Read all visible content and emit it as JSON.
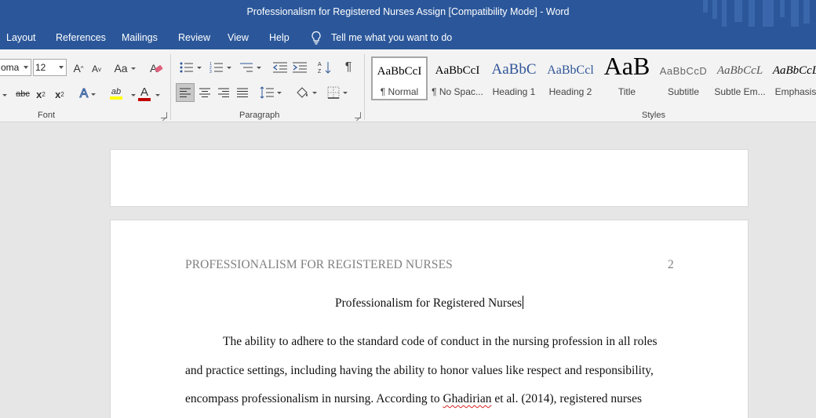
{
  "window": {
    "title": "Professionalism for Registered Nurses Assign [Compatibility Mode]  -  Word"
  },
  "menu": {
    "tabs": [
      "Layout",
      "References",
      "Mailings",
      "Review",
      "View",
      "Help"
    ],
    "tell_me": "Tell me what you want to do"
  },
  "ribbon": {
    "font": {
      "name": "oma",
      "size": "12",
      "grow_glyph": "A",
      "shrink_glyph": "A",
      "case_glyph": "Aa",
      "strike_glyph": "abc",
      "subscript_glyph": "x",
      "superscript_glyph": "x",
      "effects_glyph": "A",
      "highlight_glyph": "ab",
      "color_glyph": "A",
      "label": "Font"
    },
    "paragraph": {
      "pilcrow": "¶",
      "label": "Paragraph"
    },
    "styles": {
      "label": "Styles",
      "items": [
        {
          "sample": "AaBbCcI",
          "name": "¶ Normal"
        },
        {
          "sample": "AaBbCcI",
          "name": "¶ No Spac..."
        },
        {
          "sample": "AaBbC",
          "name": "Heading 1"
        },
        {
          "sample": "AaBbCcl",
          "name": "Heading 2"
        },
        {
          "sample": "AaB",
          "name": "Title"
        },
        {
          "sample": "AaBbCcD",
          "name": "Subtitle"
        },
        {
          "sample": "AaBbCcL",
          "name": "Subtle Em..."
        },
        {
          "sample": "AaBbCcL",
          "name": "Emphasis"
        }
      ]
    }
  },
  "colors": {
    "brand": "#2b579a",
    "highlight": "#ffff00",
    "font_color": "#c00000"
  },
  "document": {
    "header": "PROFESSIONALISM FOR REGISTERED NURSES",
    "page_number": "2",
    "title": "Professionalism for Registered Nurses",
    "lines": [
      "The ability to adhere to the standard code of conduct in the nursing profession in all roles",
      "and practice settings, including having the ability to honor values like respect and responsibility,",
      "encompass professionalism in nursing. According to"
    ],
    "cited_author": "Ghadirian",
    "line3_tail": " et al. (2014), registered nurses"
  }
}
